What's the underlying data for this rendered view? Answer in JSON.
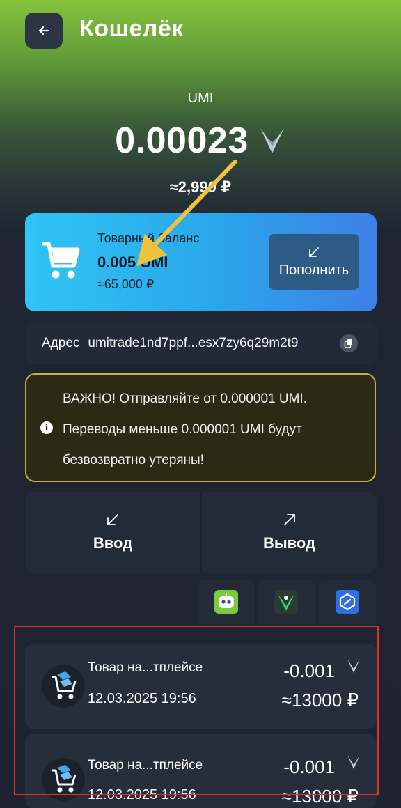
{
  "header": {
    "title": "Кошелёк",
    "back_icon": "arrow-left-icon"
  },
  "wallet": {
    "currency": "UMI",
    "balance": "0.00023",
    "fiat": "≈2,990 ₽"
  },
  "trade_balance": {
    "label": "Товарный баланс",
    "amount": "0.005 UMI",
    "fiat": "≈65,000 ₽",
    "topup_label": "Пополнить"
  },
  "address": {
    "label": "Адрес",
    "value": "umitrade1nd7ppf...esx7zy6q29m2t9"
  },
  "warning": {
    "line1": "ВАЖНО! Отправляйте от 0.000001 UMI.",
    "line2": "Переводы меньше 0.000001 UMI будут",
    "line3": "безвозвратно утеряны!"
  },
  "actions": {
    "in_label": "Ввод",
    "out_label": "Вывод"
  },
  "filters": [
    "robot-icon",
    "umi-green-icon",
    "chain-icon"
  ],
  "transactions": [
    {
      "name": "Товар на...тплейсе",
      "date": "12.03.2025 19:56",
      "amount": "-0.001",
      "fiat": "≈13000 ₽"
    },
    {
      "name": "Товар на...тплейсе",
      "date": "12.03.2025 19:56",
      "amount": "-0.001",
      "fiat": "≈13000 ₽"
    }
  ],
  "colors": {
    "accent_blue": "#2aa6ea",
    "warning_border": "#c9b034",
    "highlight_red": "#e0302a",
    "annotation_arrow": "#f2c23a"
  }
}
